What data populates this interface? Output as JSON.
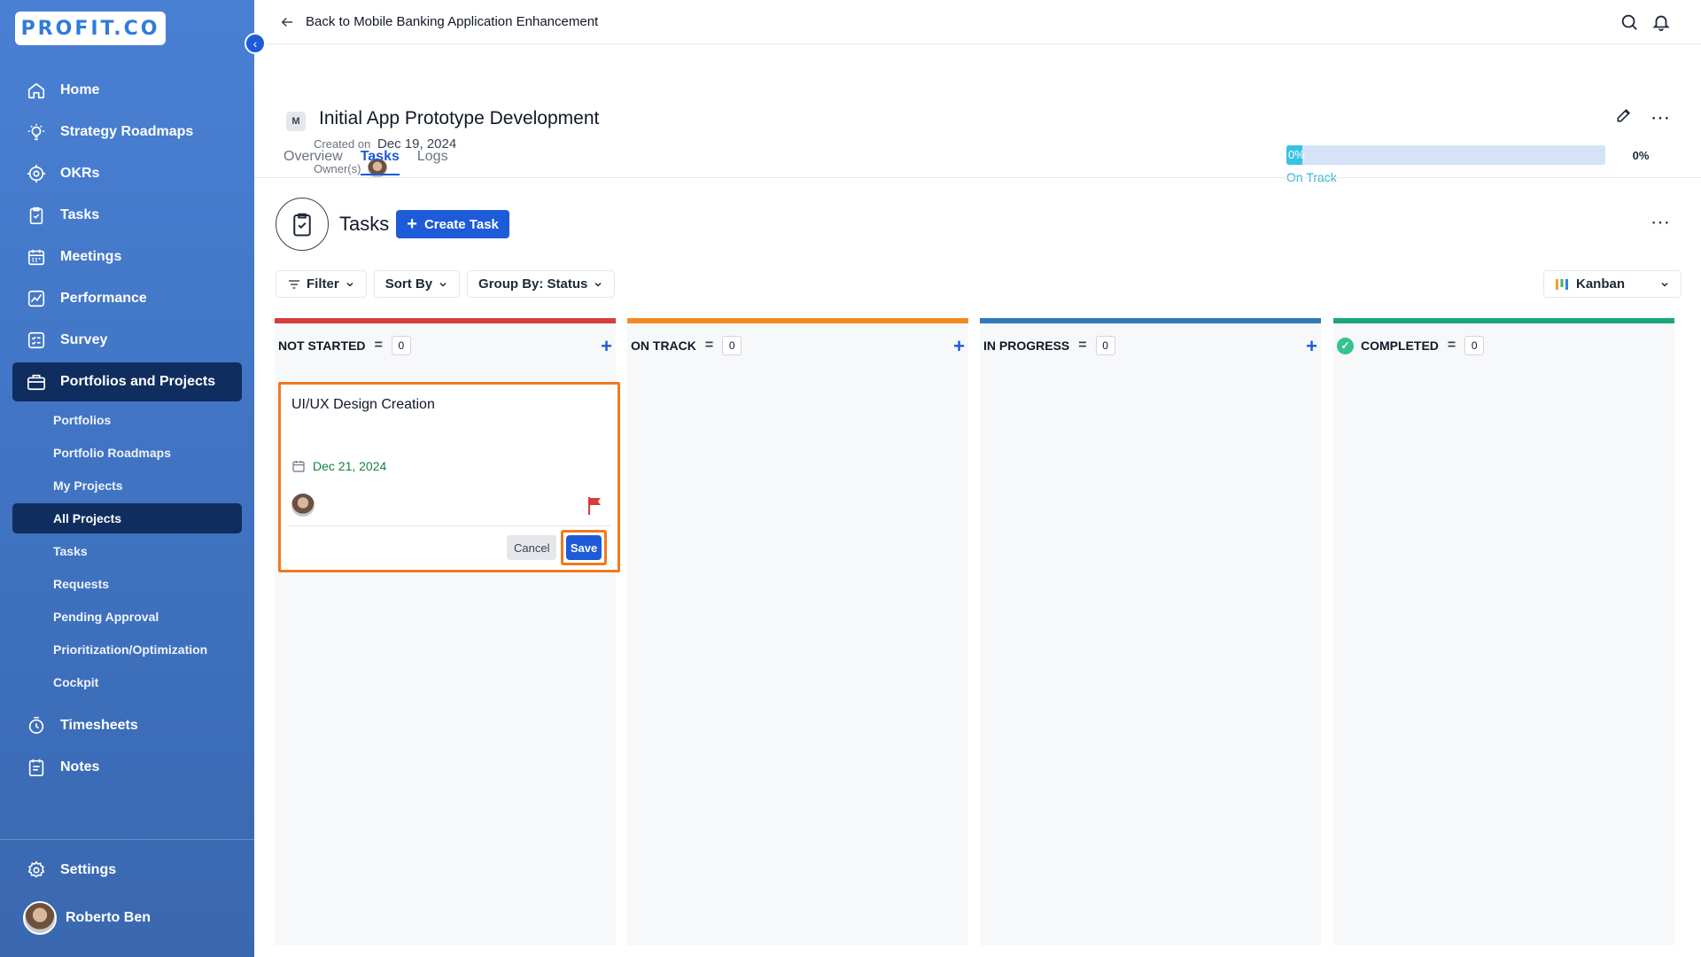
{
  "brand": {
    "logo_text": "PROFIT.CO"
  },
  "sidebar": {
    "items": [
      {
        "label": "Home",
        "icon": "home-icon"
      },
      {
        "label": "Strategy Roadmaps",
        "icon": "bulb-icon"
      },
      {
        "label": "OKRs",
        "icon": "target-icon"
      },
      {
        "label": "Tasks",
        "icon": "clipboard-icon"
      },
      {
        "label": "Meetings",
        "icon": "calendar-icon"
      },
      {
        "label": "Performance",
        "icon": "chart-icon"
      },
      {
        "label": "Survey",
        "icon": "survey-icon"
      },
      {
        "label": "Portfolios and Projects",
        "icon": "briefcase-icon"
      }
    ],
    "sub_items": [
      {
        "label": "Portfolios"
      },
      {
        "label": "Portfolio Roadmaps"
      },
      {
        "label": "My Projects"
      },
      {
        "label": "All Projects"
      },
      {
        "label": "Tasks"
      },
      {
        "label": "Requests"
      },
      {
        "label": "Pending Approval"
      },
      {
        "label": "Prioritization/Optimization"
      },
      {
        "label": "Cockpit"
      }
    ],
    "more_items": [
      {
        "label": "Timesheets",
        "icon": "clock-icon"
      },
      {
        "label": "Notes",
        "icon": "notes-icon"
      }
    ],
    "settings_label": "Settings",
    "user_name": "Roberto Ben",
    "active_item": "Portfolios and Projects",
    "active_sub_item": "All Projects"
  },
  "topbar": {
    "back_label": "Back to Mobile Banking Application Enhancement"
  },
  "project": {
    "badge": "M",
    "title": "Initial App Prototype Development",
    "created_label": "Created on",
    "created_date": "Dec 19, 2024",
    "owners_label": "Owner(s)",
    "progress": 0,
    "progress_text": "0%",
    "progress_pct_label": "0%",
    "status": "On Track"
  },
  "tabs": [
    {
      "label": "Overview"
    },
    {
      "label": "Tasks"
    },
    {
      "label": "Logs"
    }
  ],
  "tasks_section": {
    "title": "Tasks",
    "create_label": "Create Task",
    "filter_label": "Filter",
    "sort_label": "Sort By",
    "group_label": "Group By: Status",
    "view_label": "Kanban"
  },
  "columns": [
    {
      "title": "NOT STARTED",
      "count": "0",
      "color": "#d63d3d"
    },
    {
      "title": "ON TRACK",
      "count": "0",
      "color": "#f28a24"
    },
    {
      "title": "IN PROGRESS",
      "count": "0",
      "color": "#2f7ab8"
    },
    {
      "title": "COMPLETED",
      "count": "0",
      "color": "#1aa67d"
    }
  ],
  "new_task_card": {
    "name": "UI/UX Design Creation",
    "due_date": "Dec 21, 2024",
    "cancel_label": "Cancel",
    "save_label": "Save"
  },
  "colors": {
    "primary": "#1d5bd8",
    "accent_orange": "#f07921",
    "sidebar": "#4a80d4",
    "active_nav": "#0f2d5e"
  }
}
